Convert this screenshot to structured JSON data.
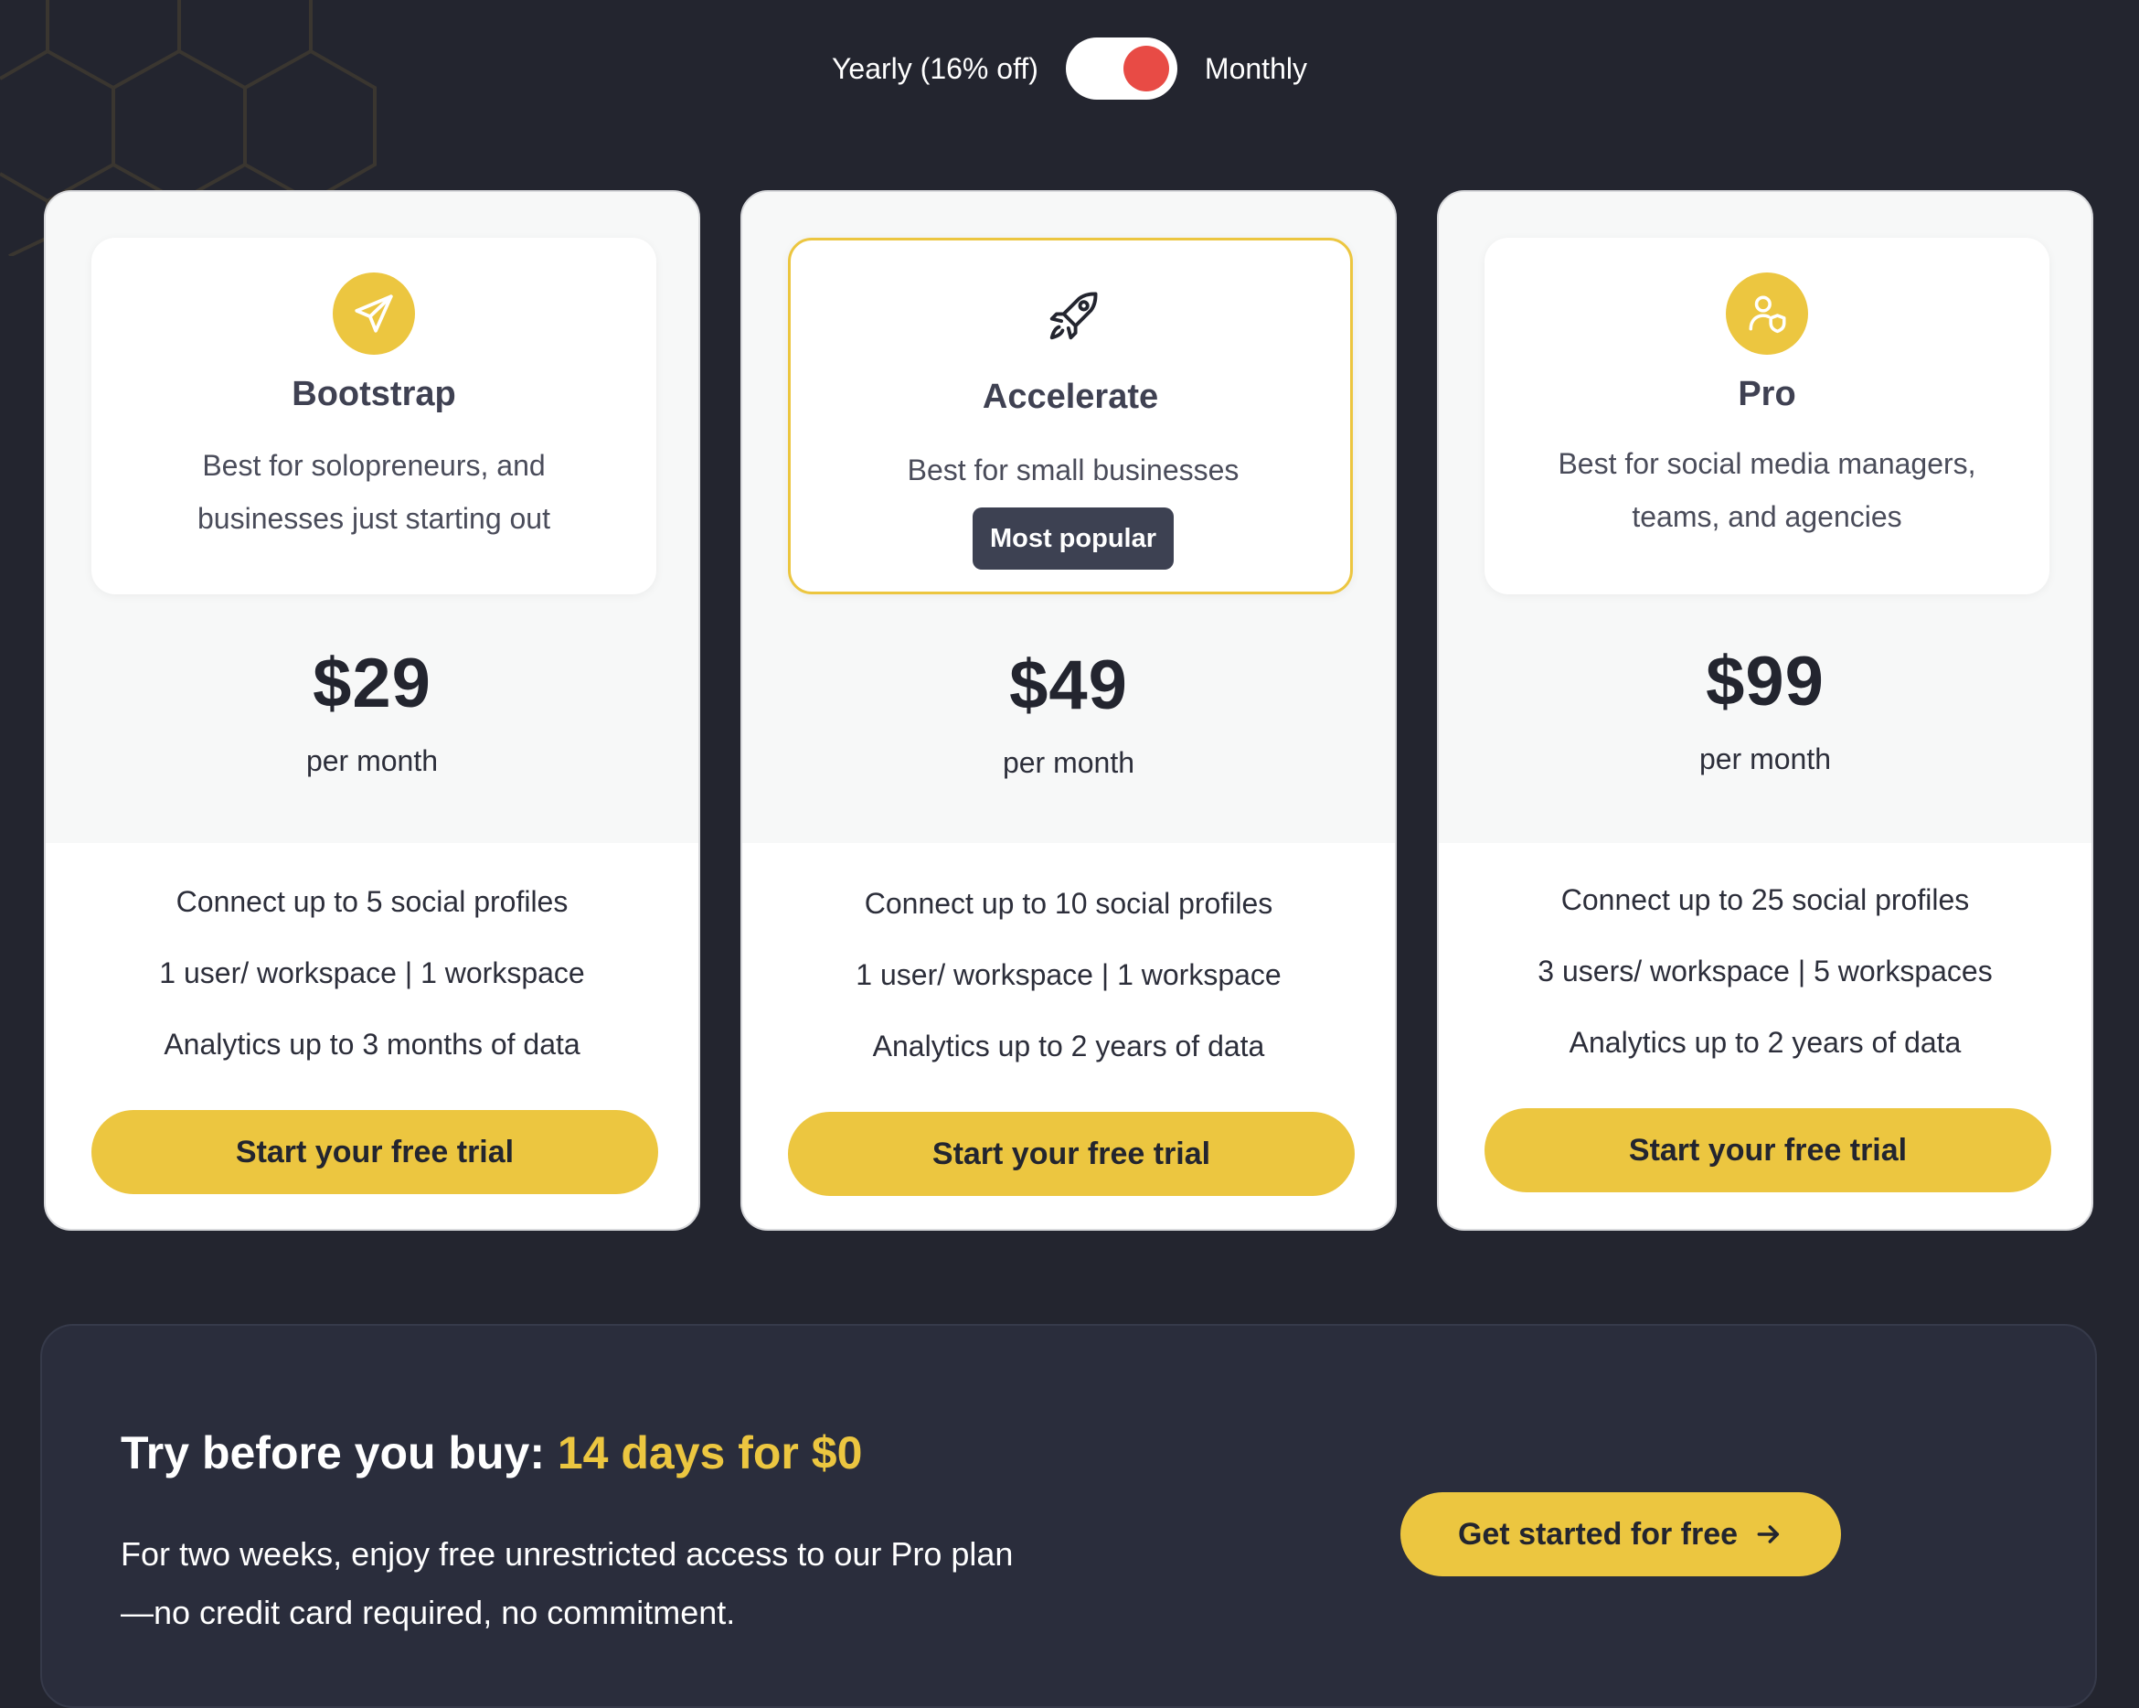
{
  "billing_toggle": {
    "yearly_label": "Yearly (16% off)",
    "monthly_label": "Monthly",
    "selected": "Monthly"
  },
  "plans": [
    {
      "name": "Bootstrap",
      "icon": "paper-plane-icon",
      "description": "Best for solopreneurs, and businesses just starting out",
      "price": "$29",
      "period": "per month",
      "features": [
        "Connect up to 5 social profiles",
        "1 user/ workspace | 1 workspace",
        "Analytics up to 3 months of data"
      ],
      "cta": "Start your free trial"
    },
    {
      "name": "Accelerate",
      "icon": "rocket-icon",
      "description": "Best for small businesses",
      "badge": "Most popular",
      "price": "$49",
      "period": "per month",
      "features": [
        "Connect up to 10 social profiles",
        "1 user/ workspace | 1 workspace",
        "Analytics up to 2 years of data"
      ],
      "cta": "Start your free trial"
    },
    {
      "name": "Pro",
      "icon": "user-shield-icon",
      "description": "Best for social media managers, teams, and agencies",
      "price": "$99",
      "period": "per month",
      "features": [
        "Connect up to 25 social profiles",
        "3 users/ workspace | 5 workspaces",
        "Analytics up to 2 years of data"
      ],
      "cta": "Start your free trial"
    }
  ],
  "trial": {
    "title_prefix": "Try before you buy: ",
    "title_highlight": "14 days for $0",
    "body": "For two weeks, enjoy free unrestricted access to our Pro plan—no credit card required, no commitment.",
    "cta": "Get started for free",
    "cta_icon": "arrow-right-icon"
  },
  "colors": {
    "background": "#23252f",
    "accent": "#ecc640",
    "toggle_knob": "#e84b45",
    "badge": "#3d4152",
    "panel": "#2a2d3c"
  }
}
